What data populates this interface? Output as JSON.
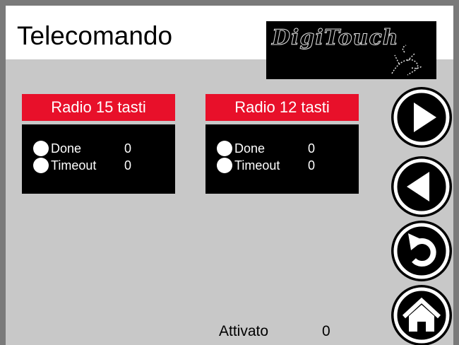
{
  "header": {
    "title": "Telecomando"
  },
  "logo": {
    "text": "DigiTouch"
  },
  "panels": [
    {
      "title": "Radio 15 tasti",
      "rows": [
        {
          "label": "Done",
          "value": "0"
        },
        {
          "label": "Timeout",
          "value": "0"
        }
      ]
    },
    {
      "title": "Radio 12 tasti",
      "rows": [
        {
          "label": "Done",
          "value": "0"
        },
        {
          "label": "Timeout",
          "value": "0"
        }
      ]
    }
  ],
  "nav": [
    {
      "icon": "play-forward-icon"
    },
    {
      "icon": "play-back-icon"
    },
    {
      "icon": "undo-icon"
    },
    {
      "icon": "home-icon"
    }
  ],
  "footer": {
    "label": "Attivato",
    "value": "0"
  },
  "colors": {
    "panel_header": "#e8102a",
    "panel_body": "#000000",
    "background": "#c8c8c8",
    "frame": "#7a7a7a"
  }
}
